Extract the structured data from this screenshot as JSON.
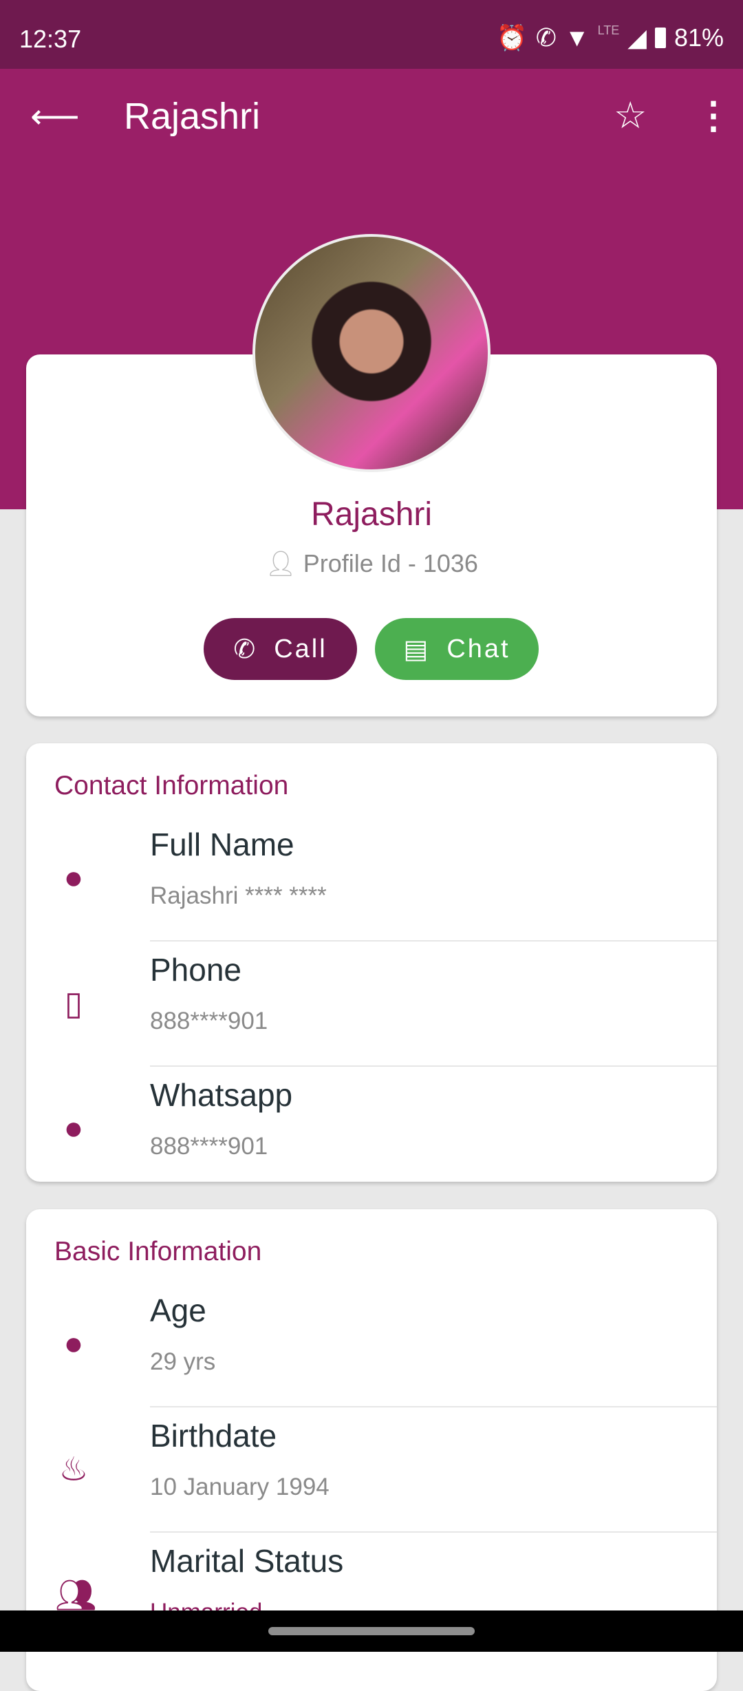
{
  "status_bar": {
    "time": "12:37",
    "lte": "LTE",
    "battery": "81%"
  },
  "app_bar": {
    "title": "Rajashri"
  },
  "profile": {
    "name": "Rajashri",
    "profile_id": "Profile Id - 1036",
    "call_label": "Call",
    "chat_label": "Chat"
  },
  "colors": {
    "primary": "#9a1f67",
    "primary_dark": "#6f1a4f",
    "accent_text": "#8e1d5e",
    "chat": "#4caf50"
  },
  "contact": {
    "title": "Contact Information",
    "rows": [
      {
        "label": "Full Name",
        "value": "Rajashri **** ****",
        "icon": "account-circle-icon"
      },
      {
        "label": "Phone",
        "value": "888****901",
        "icon": "phone-android-icon"
      },
      {
        "label": "Whatsapp",
        "value": "888****901",
        "icon": "account-circle-icon"
      }
    ]
  },
  "basic": {
    "title": "Basic Information",
    "rows": [
      {
        "label": "Age",
        "value": "29 yrs",
        "icon": "account-circle-icon"
      },
      {
        "label": "Birthdate",
        "value": "10 January 1994",
        "icon": "cake-icon"
      },
      {
        "label": "Marital Status",
        "value": "Unmarried",
        "icon": "people-icon"
      }
    ]
  }
}
